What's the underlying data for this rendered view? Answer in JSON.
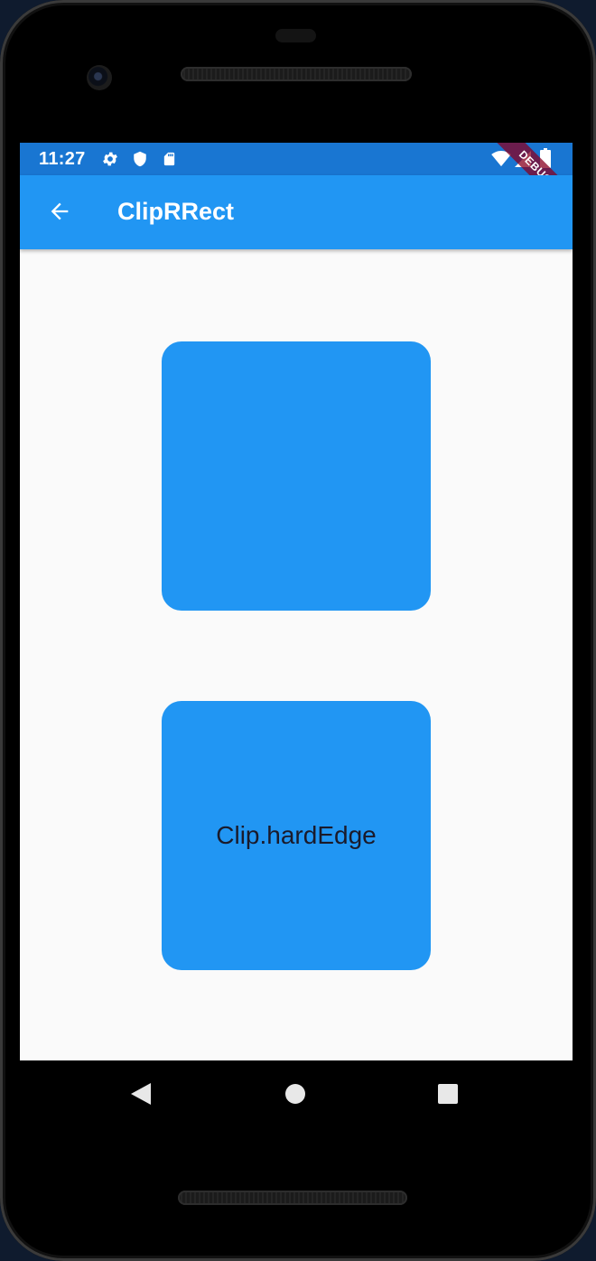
{
  "status_bar": {
    "time": "11:27",
    "icons": [
      "gear-icon",
      "shield-icon",
      "sd-card-icon"
    ],
    "right_icons": [
      "wifi-icon",
      "signal-icon",
      "battery-icon"
    ]
  },
  "app_bar": {
    "title": "ClipRRect",
    "back_icon": "arrow-back-icon"
  },
  "debug_banner": "DEBUG",
  "content": {
    "boxes": [
      {
        "label": "",
        "color": "#2196f3"
      },
      {
        "label": "Clip.hardEdge",
        "color": "#2196f3"
      }
    ]
  },
  "nav_bar": {
    "buttons": [
      "back-triangle-icon",
      "home-circle-icon",
      "recents-square-icon"
    ]
  },
  "colors": {
    "status_bar": "#1976d2",
    "app_bar": "#2196f3",
    "background": "#fafafa"
  }
}
